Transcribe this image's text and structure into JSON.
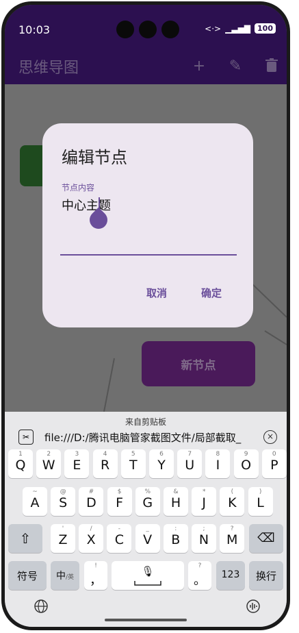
{
  "status": {
    "time": "10:03",
    "battery": "100"
  },
  "app": {
    "title": "思维导图"
  },
  "canvas": {
    "node_label": "新节点"
  },
  "dialog": {
    "title": "编辑节点",
    "field_label": "节点内容",
    "field_value": "中心主题",
    "cancel": "取消",
    "confirm": "确定"
  },
  "keyboard": {
    "clipboard_label": "来自剪贴板",
    "clipboard_text": "file:///D:/腾讯电脑管家截图文件/局部截取_",
    "row1": [
      {
        "sub": "1",
        "key": "Q"
      },
      {
        "sub": "2",
        "key": "W"
      },
      {
        "sub": "3",
        "key": "E"
      },
      {
        "sub": "4",
        "key": "R"
      },
      {
        "sub": "5",
        "key": "T"
      },
      {
        "sub": "6",
        "key": "Y"
      },
      {
        "sub": "7",
        "key": "U"
      },
      {
        "sub": "8",
        "key": "I"
      },
      {
        "sub": "9",
        "key": "O"
      },
      {
        "sub": "0",
        "key": "P"
      }
    ],
    "row2": [
      {
        "sub": "~",
        "key": "A"
      },
      {
        "sub": "@",
        "key": "S"
      },
      {
        "sub": "#",
        "key": "D"
      },
      {
        "sub": "$",
        "key": "F"
      },
      {
        "sub": "%",
        "key": "G"
      },
      {
        "sub": "&",
        "key": "H"
      },
      {
        "sub": "*",
        "key": "J"
      },
      {
        "sub": "(",
        "key": "K"
      },
      {
        "sub": ")",
        "key": "L"
      }
    ],
    "row3": [
      {
        "sub": "'",
        "key": "Z"
      },
      {
        "sub": "/",
        "key": "X"
      },
      {
        "sub": "-",
        "key": "C"
      },
      {
        "sub": "_",
        "key": "V"
      },
      {
        "sub": ":",
        "key": "B"
      },
      {
        "sub": ";",
        "key": "N"
      },
      {
        "sub": "?",
        "key": "M"
      }
    ],
    "symbols": "符号",
    "lang_main": "中",
    "lang_sub": "/英",
    "comma_sub": "!",
    "comma": "，",
    "period_sub": "?",
    "period": "。",
    "num": "123",
    "enter": "换行"
  }
}
